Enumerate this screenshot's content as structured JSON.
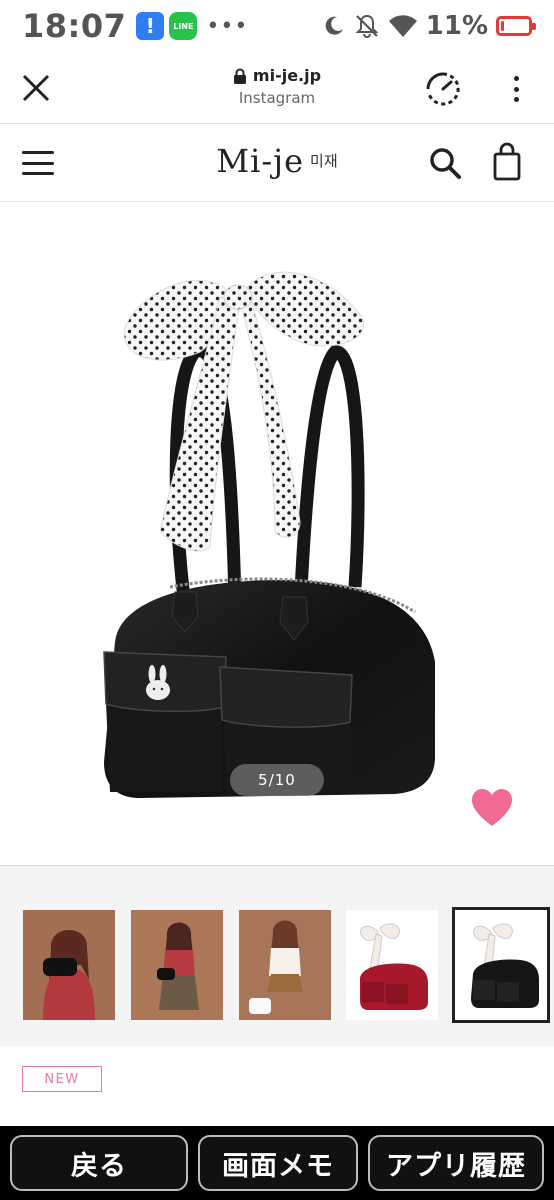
{
  "status_bar": {
    "time": "18:07",
    "battery_percent": "11%",
    "battery_level": 0.11,
    "notifications": [
      "alert-icon",
      "line-app-icon"
    ],
    "line_label": "LINE",
    "alert_glyph": "!",
    "more": "•••"
  },
  "browser": {
    "url": "mi-je.jp",
    "subtitle": "Instagram"
  },
  "site": {
    "logo": "Mi-je",
    "logo_korean": "미재"
  },
  "gallery": {
    "counter": "5/10",
    "current": 5,
    "total": 10,
    "thumbnail_count": 5,
    "selected_thumbnail": 5
  },
  "product": {
    "badge": "NEW"
  },
  "bottom_nav": {
    "back": "戻る",
    "screen_memo": "画面メモ",
    "app_history": "アプリ履歴"
  },
  "colors": {
    "heart": "#f06b93",
    "new_badge": "#e87a9c",
    "battery": "#e53935"
  }
}
